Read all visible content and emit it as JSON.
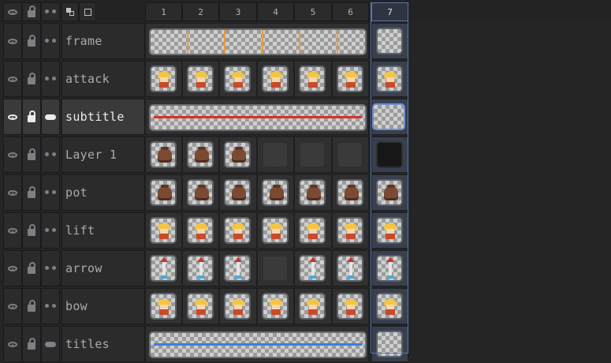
{
  "header": {
    "frames": [
      "1",
      "2",
      "3",
      "4",
      "5",
      "6",
      "7"
    ],
    "active_frame": "7",
    "icons": [
      "eye-icon",
      "lock-icon",
      "link-icon",
      "onion-skin-icon",
      "square-icon"
    ]
  },
  "layers": [
    {
      "name": "frame",
      "selected": false,
      "visible_icon": "eye-icon",
      "lock_icon": "lock-icon",
      "link_icon": "continuous-icon"
    },
    {
      "name": "attack",
      "selected": false,
      "visible_icon": "eye-icon",
      "lock_icon": "lock-icon",
      "link_icon": "continuous-icon"
    },
    {
      "name": "subtitle",
      "selected": true,
      "visible_icon": "eye-icon",
      "lock_icon": "lock-icon",
      "link_icon": "link-icon"
    },
    {
      "name": "Layer 1",
      "selected": false,
      "visible_icon": "eye-icon",
      "lock_icon": "lock-icon",
      "link_icon": "continuous-icon"
    },
    {
      "name": "pot",
      "selected": false,
      "visible_icon": "eye-icon",
      "lock_icon": "lock-icon",
      "link_icon": "continuous-icon"
    },
    {
      "name": "lift",
      "selected": false,
      "visible_icon": "eye-icon",
      "lock_icon": "lock-icon",
      "link_icon": "continuous-icon"
    },
    {
      "name": "arrow",
      "selected": false,
      "visible_icon": "eye-icon",
      "lock_icon": "lock-icon",
      "link_icon": "continuous-icon"
    },
    {
      "name": "bow",
      "selected": false,
      "visible_icon": "eye-icon",
      "lock_icon": "lock-icon",
      "link_icon": "continuous-icon"
    },
    {
      "name": "titles",
      "selected": false,
      "visible_icon": "eye-icon",
      "lock_icon": "lock-icon",
      "link_icon": "link-icon"
    }
  ],
  "colors": {
    "background": "#252525",
    "active_frame_border": "#5a76b0",
    "frame_marker": "#e89a3a"
  }
}
